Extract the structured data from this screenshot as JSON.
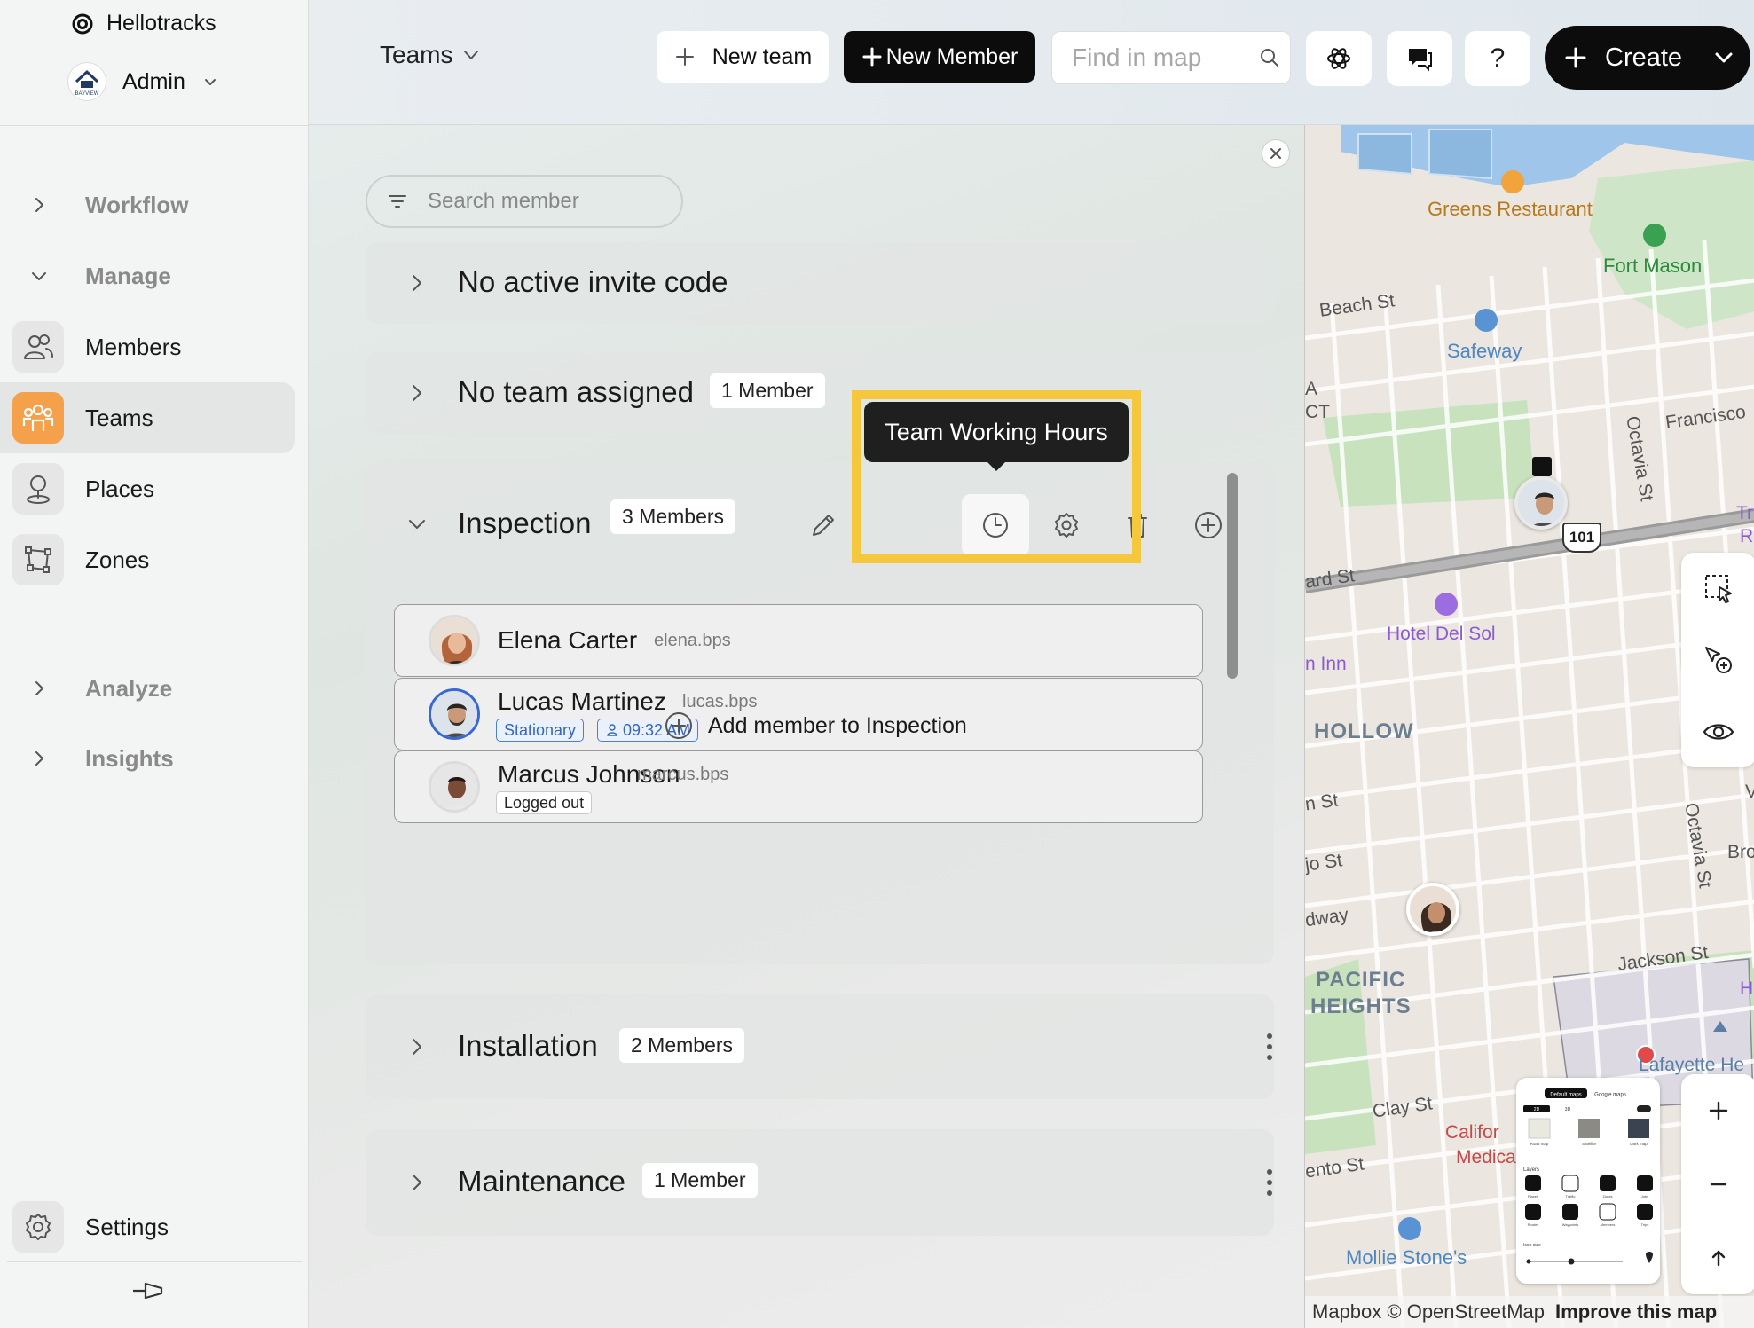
{
  "app": {
    "brand": "Hellotracks",
    "org_logo_text": "BAYVIEW",
    "org_name": "Admin"
  },
  "sidebar": {
    "sections": [
      {
        "label": "Workflow",
        "expanded": false
      },
      {
        "label": "Manage",
        "expanded": true
      },
      {
        "label": "Analyze",
        "expanded": false
      },
      {
        "label": "Insights",
        "expanded": false
      }
    ],
    "items": [
      {
        "label": "Members",
        "icon": "members-icon"
      },
      {
        "label": "Teams",
        "icon": "teams-icon",
        "active": true
      },
      {
        "label": "Places",
        "icon": "place-pin-icon"
      },
      {
        "label": "Zones",
        "icon": "zone-icon"
      }
    ],
    "settings_label": "Settings"
  },
  "topbar": {
    "view_select": "Teams",
    "new_team": "New team",
    "new_member": "New Member",
    "find_placeholder": "Find in map",
    "help": "?",
    "create": "Create"
  },
  "panel": {
    "search_placeholder": "Search member",
    "invite": {
      "title": "No active invite code"
    },
    "unassigned": {
      "title": "No team assigned",
      "count": "1 Member"
    },
    "inspection": {
      "title": "Inspection",
      "count": "3 Members",
      "tooltip": "Team Working Hours",
      "members": [
        {
          "name": "Elena Carter",
          "username": "elena.bps",
          "tags": []
        },
        {
          "name": "Lucas Martinez",
          "username": "lucas.bps",
          "tags": [
            "Stationary",
            "09:32 AM"
          ]
        },
        {
          "name": "Marcus Johnson",
          "username": "marcus.bps",
          "tags": [
            "Logged out"
          ]
        }
      ],
      "add_member": "Add member to Inspection"
    },
    "installation": {
      "title": "Installation",
      "count": "2 Members"
    },
    "maintenance": {
      "title": "Maintenance",
      "count": "1 Member"
    }
  },
  "map": {
    "labels": {
      "greens": "Greens Restaurant",
      "fort_mason": "Fort Mason",
      "beach_st": "Beach St",
      "safeway": "Safeway",
      "francisco": "Francisco",
      "octavia1": "Octavia St",
      "octavia2": "Octavia St",
      "highway": "101",
      "lombard": "ard St",
      "hotel": "Hotel Del Sol",
      "inn": "n Inn",
      "hollow": "HOLLOW",
      "union": "n St",
      "vallejo": "jo St",
      "broadway": "dway",
      "bro": "Bro",
      "pacific": "PACIFIC",
      "heights": "HEIGHTS",
      "jackson": "Jackson St",
      "lafayette": "Lafayette He",
      "clay": "Clay St",
      "sacramento": "ento St",
      "cpmc1": "Califor",
      "cpmc2": "Medica",
      "mollie": "Mollie Stone's",
      "a": "A",
      "ct": "CT",
      "tr": "Tr",
      "r": "R",
      "v": "V",
      "h": "H"
    },
    "layers_panel": {
      "tab_default": "Default maps",
      "tab_google": "Google maps",
      "modes": [
        "2D",
        "3D"
      ],
      "styles": [
        "Road map",
        "Satellite",
        "Dark map"
      ],
      "layers_title": "Layers",
      "layers": [
        "Places",
        "Traffic",
        "Zones",
        "Jobs",
        "Routes",
        "Waypoints",
        "Members",
        "Trips"
      ],
      "icon_size": "Icon size"
    },
    "attribution": "Mapbox © OpenStreetMap",
    "improve": "Improve this map"
  },
  "colors": {
    "accent": "#f5a04a",
    "highlight": "#f5c73d",
    "primary": "#0c0c0c",
    "status_blue": "#3466c2"
  }
}
